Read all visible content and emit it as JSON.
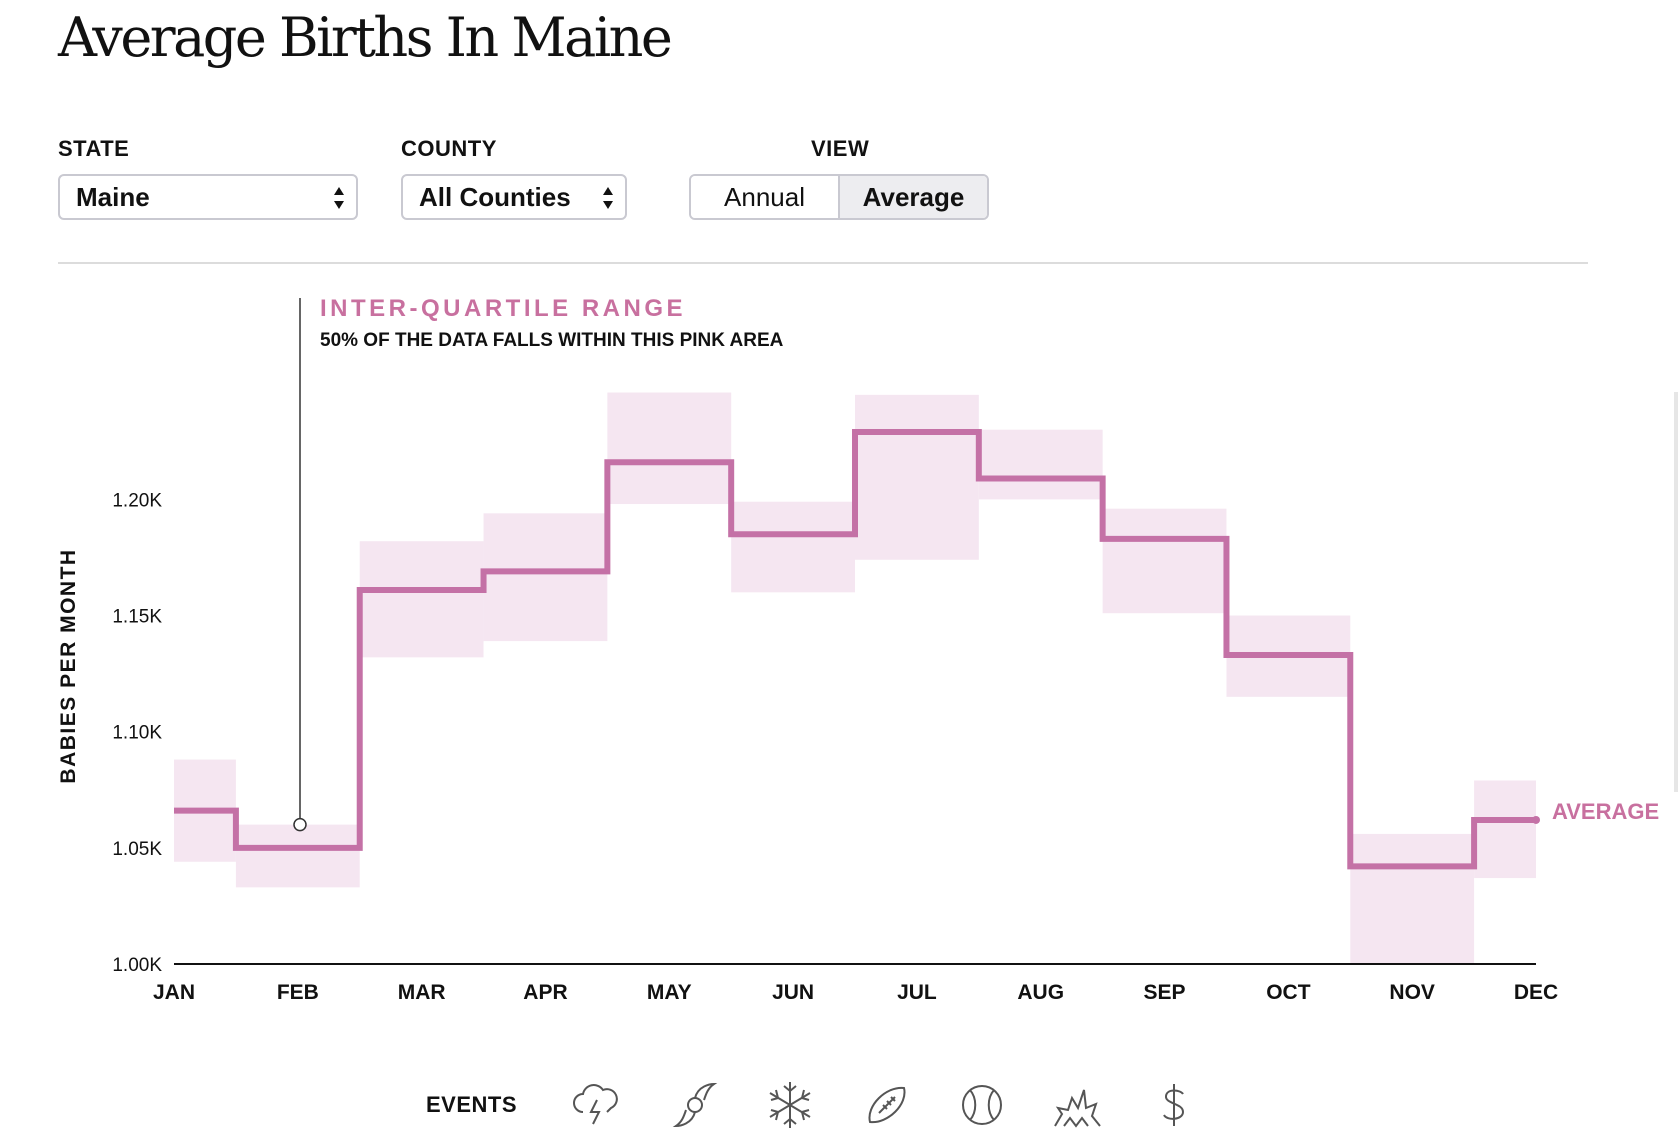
{
  "title": "Average Births In Maine",
  "controls": {
    "state": {
      "label": "STATE",
      "value": "Maine"
    },
    "county": {
      "label": "COUNTY",
      "value": "All Counties"
    },
    "view": {
      "label": "VIEW",
      "options": [
        "Annual",
        "Average"
      ],
      "selected": "Average"
    }
  },
  "annotation": {
    "title": "INTER-QUARTILE RANGE",
    "subtitle": "50% OF THE DATA FALLS WITHIN THIS PINK AREA"
  },
  "events": {
    "label": "EVENTS",
    "icons": [
      "storm-icon",
      "hurricane-icon",
      "snowflake-icon",
      "football-icon",
      "baseball-icon",
      "fireworks-icon",
      "dollar-icon"
    ]
  },
  "colors": {
    "line": "#c471a6",
    "band": "#f5e6f1",
    "annotation": "#c8709f"
  },
  "chart_data": {
    "type": "line",
    "step": true,
    "ylabel": "BABIES PER MONTH",
    "xlabel": "",
    "categories": [
      "JAN",
      "FEB",
      "MAR",
      "APR",
      "MAY",
      "JUN",
      "JUL",
      "AUG",
      "SEP",
      "OCT",
      "NOV",
      "DEC"
    ],
    "ylim": [
      1000,
      1260
    ],
    "yticks": [
      1000,
      1050,
      1100,
      1150,
      1200
    ],
    "ytick_labels": [
      "1.00K",
      "1.05K",
      "1.10K",
      "1.15K",
      "1.20K"
    ],
    "series": [
      {
        "name": "AVERAGE",
        "values": [
          1066,
          1050,
          1161,
          1169,
          1216,
          1185,
          1229,
          1209,
          1183,
          1133,
          1042,
          1062
        ]
      }
    ],
    "iqr": {
      "low": [
        1044,
        1033,
        1132,
        1139,
        1198,
        1160,
        1174,
        1200,
        1151,
        1115,
        1000,
        1037
      ],
      "high": [
        1088,
        1060,
        1182,
        1194,
        1246,
        1199,
        1245,
        1230,
        1196,
        1150,
        1056,
        1079
      ]
    },
    "grid": false,
    "legend": "none"
  }
}
